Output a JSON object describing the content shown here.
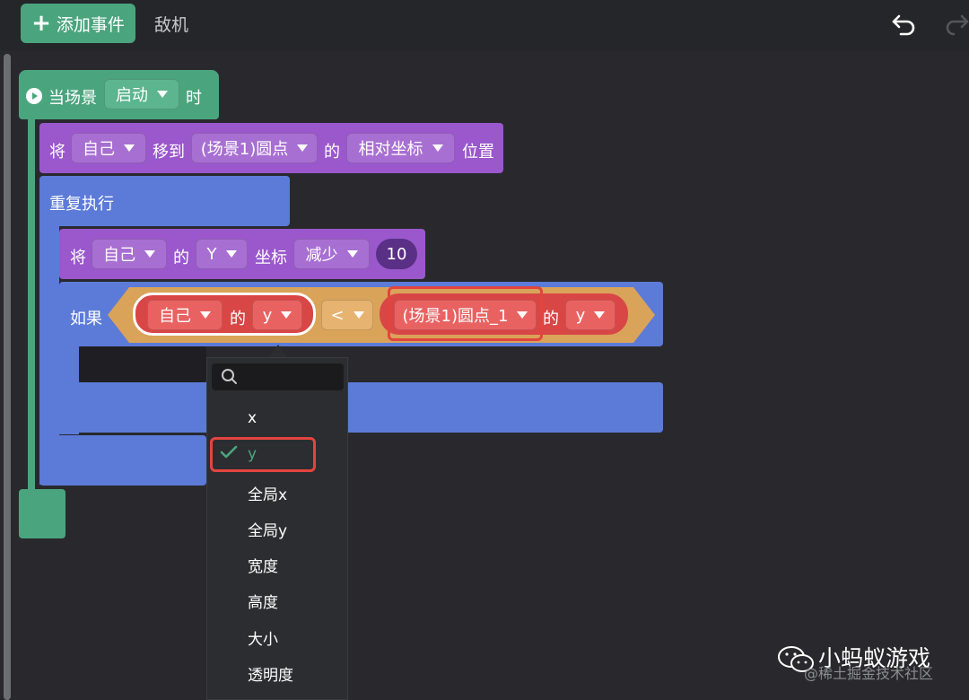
{
  "toolbar": {
    "add_event_label": "添加事件",
    "tab_label": "敌机"
  },
  "event_block": {
    "prefix": "当场景",
    "dropdown": "启动",
    "suffix": "时"
  },
  "move_block": {
    "verb": "将",
    "subject": "自己",
    "move_to": "移到",
    "target": "(场景1)圆点",
    "of": "的",
    "coord_type": "相对坐标",
    "position": "位置"
  },
  "repeat_block": {
    "label": "重复执行"
  },
  "change_block": {
    "verb": "将",
    "subject": "自己",
    "of": "的",
    "axis": "Y",
    "coord": "坐标",
    "op": "减少",
    "amount": "10"
  },
  "if_block": {
    "label": "如果",
    "left_subject": "自己",
    "left_of": "的",
    "left_prop": "y",
    "comparator": "<",
    "right_subject": "(场景1)圆点_1",
    "right_of": "的",
    "right_prop": "y"
  },
  "dropdown": {
    "items": [
      "x",
      "y",
      "全局x",
      "全局y",
      "宽度",
      "高度",
      "大小",
      "透明度"
    ],
    "selected": "y"
  },
  "watermark": {
    "title": "小蚂蚁游戏",
    "sub": "@稀土掘金技术社区"
  },
  "colors": {
    "event": "#4aa57e",
    "motion": "#9a58cc",
    "control": "#5c7bd8",
    "operator": "#d9a35a",
    "sensing": "#d94646",
    "highlight": "#e3443f"
  }
}
